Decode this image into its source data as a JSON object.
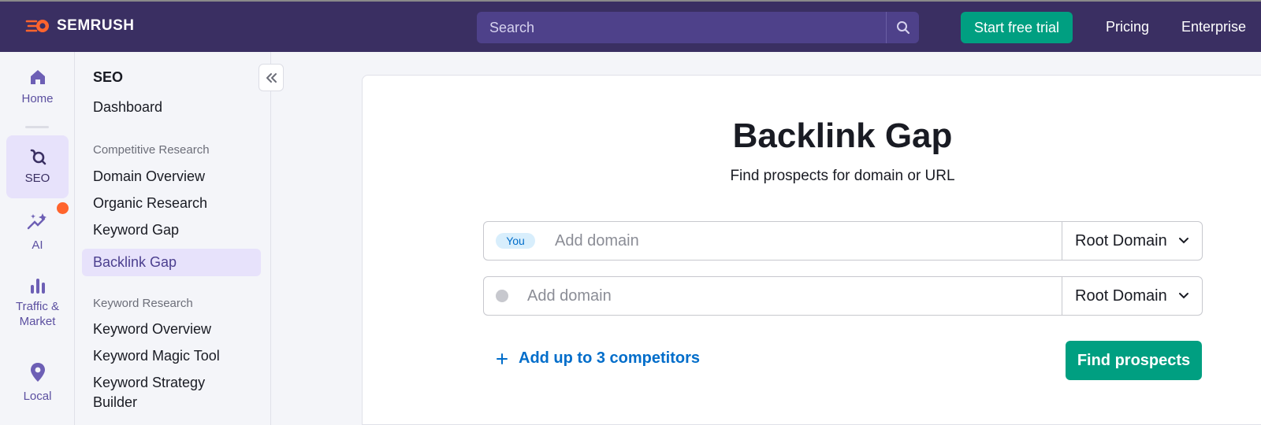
{
  "header": {
    "brand": "SEMRUSH",
    "search": {
      "placeholder": "Search"
    },
    "trial_label": "Start free trial",
    "pricing_label": "Pricing",
    "enterprise_label": "Enterprise"
  },
  "rail": {
    "items": [
      {
        "label": "Home",
        "icon": "home-icon"
      },
      {
        "label": "SEO",
        "icon": "seo-icon",
        "active": true
      },
      {
        "label": "AI",
        "icon": "sparkles-icon"
      },
      {
        "label": "Traffic & Market",
        "icon": "bar-chart-icon"
      },
      {
        "label": "Local",
        "icon": "location-pin-icon"
      }
    ]
  },
  "subnav": {
    "title": "SEO",
    "dashboard": "Dashboard",
    "sections": [
      {
        "label": "Competitive Research",
        "items": [
          "Domain Overview",
          "Organic Research",
          "Keyword Gap",
          "Backlink Gap"
        ]
      },
      {
        "label": "Keyword Research",
        "items": [
          "Keyword Overview",
          "Keyword Magic Tool",
          "Keyword Strategy Builder"
        ]
      }
    ],
    "active_item": "Backlink Gap"
  },
  "main": {
    "title": "Backlink Gap",
    "subtitle": "Find prospects for domain or URL",
    "rows": [
      {
        "badge": "You",
        "placeholder": "Add domain",
        "scope": "Root Domain"
      },
      {
        "badge": "",
        "placeholder": "Add domain",
        "scope": "Root Domain"
      }
    ],
    "add_competitors_label": "Add up to 3 competitors",
    "find_label": "Find prospects"
  },
  "colors": {
    "header_bg": "#3a2f62",
    "search_bg": "#4e418a",
    "accent_green": "#009f81",
    "brand_orange": "#ff642d",
    "link_blue": "#006dca",
    "active_purple": "#e7e2fb"
  }
}
